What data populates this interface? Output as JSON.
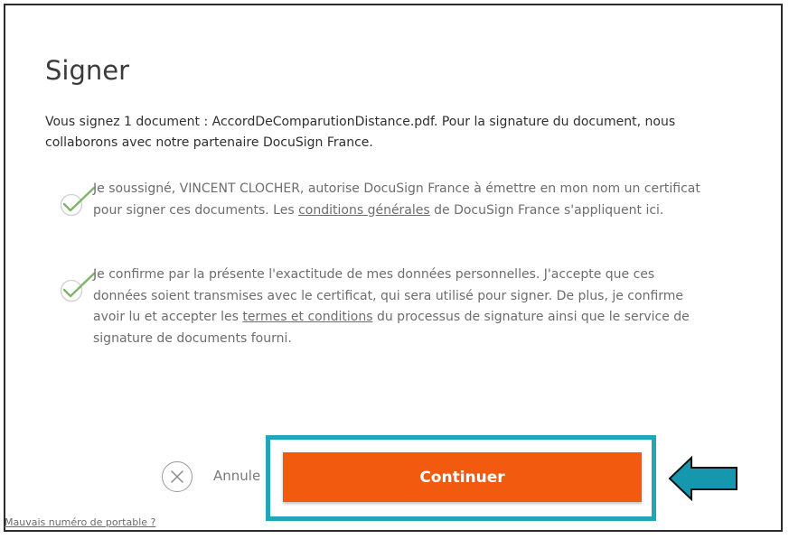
{
  "dialog": {
    "title": "Signer",
    "intro": "Vous signez 1 document : AccordDeComparutionDistance.pdf. Pour la signature du document, nous collaborons avec notre partenaire DocuSign France."
  },
  "consents": [
    {
      "text_before": "Je soussigné, VINCENT CLOCHER, autorise DocuSign France à émettre en mon nom un certificat pour signer ces documents. Les ",
      "link": "conditions générales",
      "text_after": " de DocuSign France s'appliquent ici.",
      "checked": true
    },
    {
      "text_before": "Je confirme par la présente l'exactitude de mes données personnelles. J'accepte que ces données soient transmises avec le certificat, qui sera utilisé pour signer. De plus, je confirme avoir lu et accepter les ",
      "link": "termes et conditions",
      "text_after": " du processus de signature ainsi que le service de signature de documents fourni.",
      "checked": true
    }
  ],
  "actions": {
    "cancel_label": "Annule",
    "continue_label": "Continuer"
  },
  "footer": {
    "mobile_link": "Mauvais numéro de portable ?"
  },
  "icons": {
    "check": "checkmark-icon",
    "cancel": "close-circle-icon",
    "arrow": "arrow-left-icon"
  },
  "colors": {
    "accent_button": "#f25a10",
    "highlight_border": "#1fa7b8",
    "arrow_fill": "#1597ad",
    "check_color": "#7fb56a"
  }
}
